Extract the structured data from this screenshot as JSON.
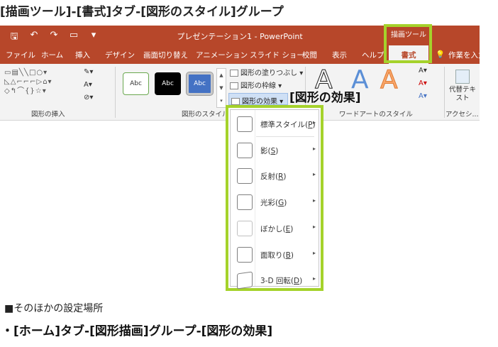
{
  "caption_top": "[描画ツール]-[書式]タブ-[図形のスタイル]グループ",
  "titlebar": {
    "title": "プレゼンテーション1 - PowerPoint",
    "context_label": "描画ツール"
  },
  "tabs": [
    "ファイル",
    "ホーム",
    "挿入",
    "デザイン",
    "画面切り替え",
    "アニメーション",
    "スライド ショー",
    "校閲",
    "表示",
    "ヘルプ"
  ],
  "active_tab": "書式",
  "tell_me": "作業を入力",
  "ribbon": {
    "insert_shapes_label": "図形の挿入",
    "shape_styles_label": "図形のスタイル",
    "wordart_label": "ワードアートのスタイル",
    "accessibility_label": "アクセシ...",
    "swatch_text": "Abc",
    "fill_label": "図形の塗りつぶし",
    "outline_label": "図形の枠線",
    "effects_label": "図形の効果",
    "alt_text_label": "代替テキスト"
  },
  "effects_annotation": "[図形の効果]",
  "menu": {
    "items": [
      {
        "label": "標準スタイル",
        "key": "P"
      },
      {
        "label": "影",
        "key": "S"
      },
      {
        "label": "反射",
        "key": "R"
      },
      {
        "label": "光彩",
        "key": "G"
      },
      {
        "label": "ぼかし",
        "key": "E"
      },
      {
        "label": "面取り",
        "key": "B"
      },
      {
        "label": "3-D 回転",
        "key": "D"
      }
    ]
  },
  "bottom_note": "■そのほかの設定場所",
  "bottom_caption": "・[ホーム]タブ-[図形描画]グループ-[図形の効果]",
  "colors": {
    "ribbon_brand": "#b7472a",
    "highlight": "#a5d22b"
  }
}
